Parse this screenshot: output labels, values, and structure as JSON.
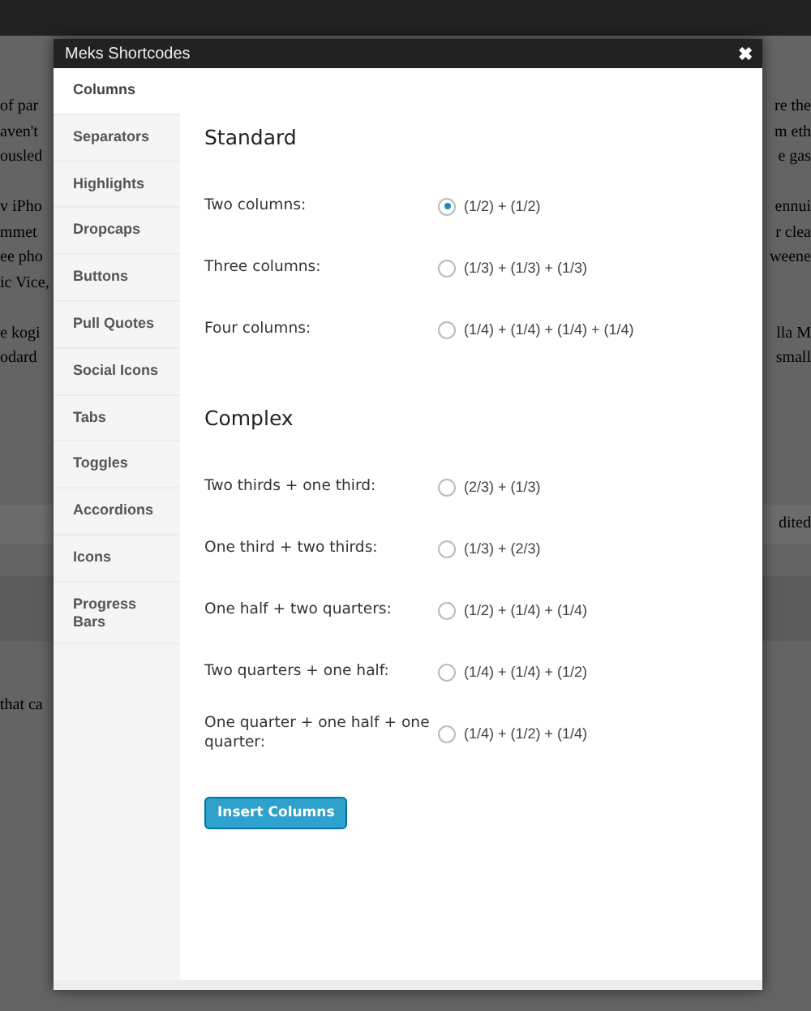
{
  "background": {
    "paragraphs": [
      {
        "lines": [
          {
            "left": "of par",
            "right": "re the"
          },
          {
            "left": "aven't",
            "right": "m eth"
          },
          {
            "left": "ousled",
            "right": "e gas"
          }
        ]
      },
      {
        "lines": [
          {
            "left": "v iPho",
            "right": "ennui"
          },
          {
            "left": "mmet",
            "right": "r clea"
          },
          {
            "left": "ee pho",
            "right": "weene"
          },
          {
            "left": "ic Vice,"
          }
        ]
      },
      {
        "lines": [
          {
            "left": "e kogi",
            "right": "lla M"
          },
          {
            "left": "odard",
            "right": "small"
          }
        ]
      }
    ],
    "lower_right": "dited",
    "lower_left": "that ca"
  },
  "dialog": {
    "title": "Meks Shortcodes",
    "close": "✖"
  },
  "sidebar": {
    "items": [
      {
        "label": "Columns",
        "selected": true
      },
      {
        "label": "Separators",
        "selected": false
      },
      {
        "label": "Highlights",
        "selected": false
      },
      {
        "label": "Dropcaps",
        "selected": false
      },
      {
        "label": "Buttons",
        "selected": false
      },
      {
        "label": "Pull Quotes",
        "selected": false
      },
      {
        "label": "Social Icons",
        "selected": false
      },
      {
        "label": "Tabs",
        "selected": false
      },
      {
        "label": "Toggles",
        "selected": false
      },
      {
        "label": "Accordions",
        "selected": false
      },
      {
        "label": "Icons",
        "selected": false
      },
      {
        "label": "Progress Bars",
        "selected": false
      }
    ]
  },
  "sections": [
    {
      "title": "Standard",
      "options": [
        {
          "label": "Two columns:",
          "value": "(1/2) + (1/2)",
          "selected": true
        },
        {
          "label": "Three columns:",
          "value": "(1/3) + (1/3) + (1/3)",
          "selected": false
        },
        {
          "label": "Four columns:",
          "value": "(1/4) + (1/4) + (1/4) + (1/4)",
          "selected": false
        }
      ]
    },
    {
      "title": "Complex",
      "options": [
        {
          "label": "Two thirds + one third:",
          "value": "(2/3) + (1/3)",
          "selected": false
        },
        {
          "label": "One third + two thirds:",
          "value": "(1/3) + (2/3)",
          "selected": false
        },
        {
          "label": "One half + two quarters:",
          "value": "(1/2) + (1/4) + (1/4)",
          "selected": false
        },
        {
          "label": "Two quarters + one half:",
          "value": "(1/4) + (1/4) + (1/2)",
          "selected": false
        },
        {
          "label": "One quarter + one half + one quarter:",
          "value": "(1/4) + (1/2) + (1/4)",
          "selected": false
        }
      ]
    }
  ],
  "button": {
    "label": "Insert Columns"
  }
}
